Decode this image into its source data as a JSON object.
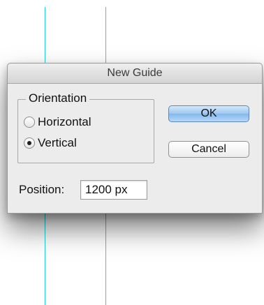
{
  "dialog": {
    "title": "New Guide",
    "orientation": {
      "legend": "Orientation",
      "options": [
        {
          "label": "Horizontal",
          "selected": false
        },
        {
          "label": "Vertical",
          "selected": true
        }
      ]
    },
    "position": {
      "label": "Position:",
      "value": "1200 px"
    },
    "buttons": {
      "ok": "OK",
      "cancel": "Cancel"
    }
  },
  "colors": {
    "guide_line": "#22d4d4",
    "ok_button": "#9cc6f0",
    "dialog_background": "#ececec"
  }
}
